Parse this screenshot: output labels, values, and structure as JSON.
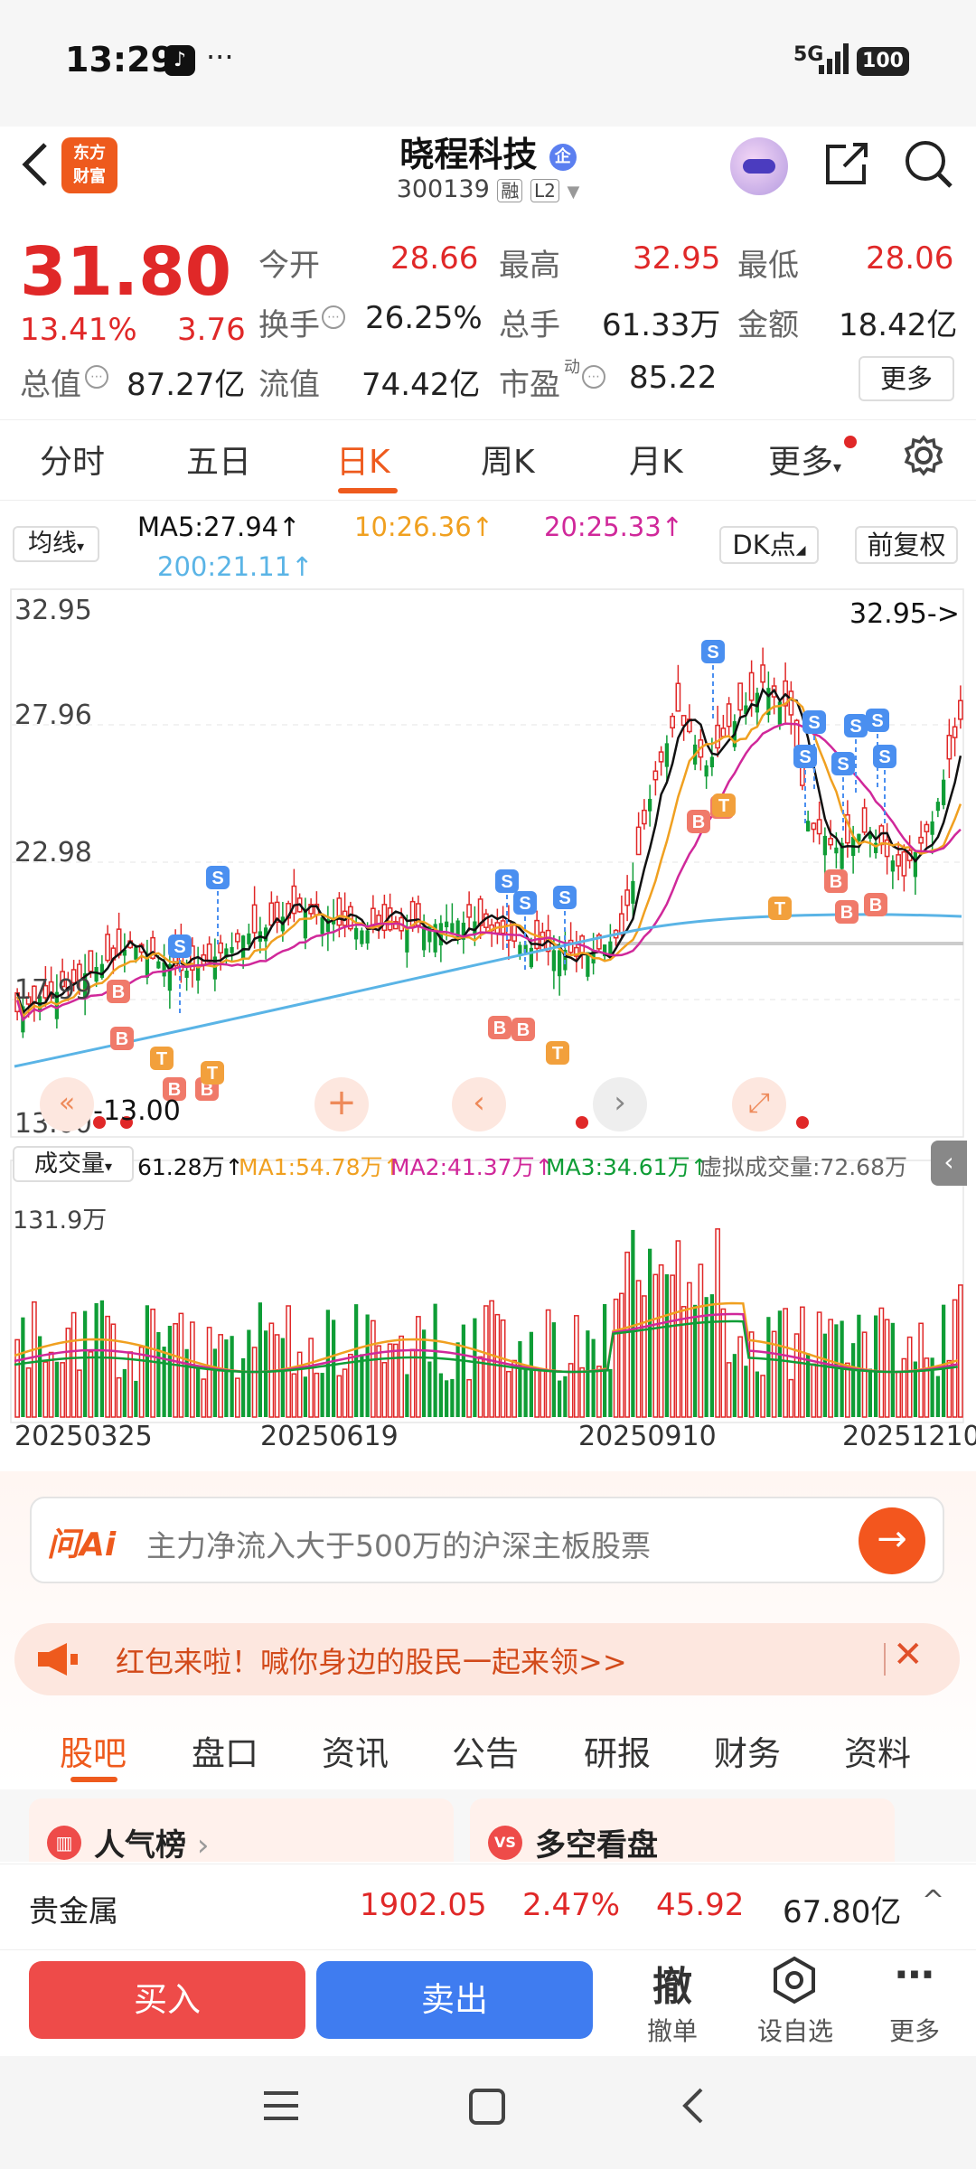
{
  "status": {
    "time": "13:29",
    "network": "5G",
    "battery": "100"
  },
  "header": {
    "name": "晓程科技",
    "code": "300139",
    "badge1": "融",
    "badge2": "L2",
    "logo_line1": "东方",
    "logo_line2": "财富",
    "qi": "企"
  },
  "quote": {
    "price": "31.80",
    "pct": "13.41%",
    "chg": "3.76",
    "open_label": "今开",
    "open": "28.66",
    "high_label": "最高",
    "high": "32.95",
    "low_label": "最低",
    "low": "28.06",
    "turnover_label": "换手",
    "turnover": "26.25%",
    "vol_label": "总手",
    "vol": "61.33万",
    "amount_label": "金额",
    "amount": "18.42亿",
    "mcap_label": "总值",
    "mcap": "87.27亿",
    "float_label": "流值",
    "float": "74.42亿",
    "pe_label": "市盈",
    "pe_sup": "动",
    "pe": "85.22",
    "more": "更多"
  },
  "tabs": [
    "分时",
    "五日",
    "日K",
    "周K",
    "月K",
    "更多"
  ],
  "kline": {
    "indicator_btn": "均线",
    "ma5": "MA5:27.94",
    "ma10": "10:26.36",
    "ma20": "20:25.33",
    "ma200": "200:21.11",
    "dk_btn": "DK点",
    "adj_btn": "前复权",
    "y_top": "32.95",
    "y2": "27.96",
    "y3": "22.98",
    "y4": "17.99",
    "y_bottom": "13.00",
    "max_marker": "32.95->",
    "min_marker": "<-13.00"
  },
  "volume": {
    "label": "成交量",
    "current": "61.28万",
    "ma1": "MA1:54.78万",
    "ma2": "MA2:41.37万",
    "ma3": "MA3:34.61万",
    "virtual": "虚拟成交量:72.68万",
    "y_top": "131.9万"
  },
  "dates": [
    "20250325",
    "20250619",
    "20250910",
    "20251210"
  ],
  "ai": {
    "logo": "问Ai",
    "placeholder": "主力净流入大于500万的沪深主板股票"
  },
  "notice": {
    "text": "红包来啦！喊你身边的股民一起来领>>"
  },
  "bottom_tabs": [
    "股吧",
    "盘口",
    "资讯",
    "公告",
    "研报",
    "财务",
    "资料"
  ],
  "cards": [
    "人气榜",
    "多空看盘"
  ],
  "ticker": {
    "name": "贵金属",
    "value": "1902.05",
    "pct": "2.47%",
    "chg": "45.92",
    "amount": "67.80亿"
  },
  "actions": {
    "buy": "买入",
    "sell": "卖出",
    "cancel_icon": "撤",
    "cancel": "撤单",
    "set": "设自选",
    "more": "更多"
  },
  "colors": {
    "up": "#e02828",
    "down": "#0f9d36",
    "accent": "#ee5a1d",
    "ma5": "#111111",
    "ma10": "#f0a020",
    "ma20": "#d0289a",
    "ma200": "#5ab4e6"
  }
}
